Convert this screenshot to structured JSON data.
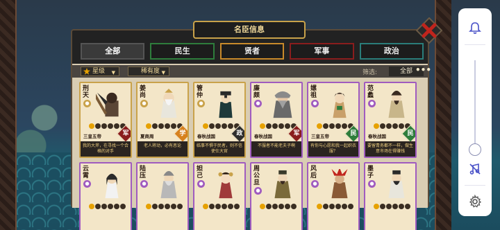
{
  "panel_title": "名臣信息",
  "tabs": [
    {
      "label": "全部",
      "active": true,
      "border": "#555555"
    },
    {
      "label": "民生",
      "active": false,
      "border": "#2e7d3c"
    },
    {
      "label": "贤者",
      "active": false,
      "border": "#c98a2a"
    },
    {
      "label": "军事",
      "active": false,
      "border": "#8a1d1d"
    },
    {
      "label": "政治",
      "active": false,
      "border": "#2a7d7a"
    }
  ],
  "filter": {
    "sort_star": "星级",
    "sort_rarity": "稀有度",
    "filter_label": "筛选:",
    "filter_value": "全部",
    "more": "•••"
  },
  "cards": [
    {
      "name": "刑天",
      "rarity": "gold",
      "era": "三皇五帝",
      "type": "军",
      "type_class": "type-mil",
      "stars": 1,
      "quote": "我的大斧，在寻找一个合格的对手",
      "portrait": "axe-warrior"
    },
    {
      "name": "姜尚",
      "rarity": "gold",
      "era": "夏商周",
      "type": "学",
      "type_class": "type-edu",
      "stars": 1,
      "quote": "老人将动，必有恶论",
      "portrait": "old-sage"
    },
    {
      "name": "管仲",
      "rarity": "gold",
      "era": "春秋战国",
      "type": "政",
      "type_class": "type-gov",
      "stars": 1,
      "quote": "临事不惧于民者，则不信使仕大官",
      "portrait": "official"
    },
    {
      "name": "廉颇",
      "rarity": "purple",
      "era": "春秋战国",
      "type": "军",
      "type_class": "type-mil",
      "stars": 1,
      "quote": "不服者不能老夫子啊",
      "portrait": "general"
    },
    {
      "name": "嫘祖",
      "rarity": "purple",
      "era": "三皇五帝",
      "type": "民",
      "type_class": "type-civ",
      "stars": 1,
      "quote": "有你与心愿和我一起织衣服？",
      "portrait": "lady"
    },
    {
      "name": "范蠡",
      "rarity": "purple",
      "era": "春秋战国",
      "type": "民",
      "type_class": "type-civ",
      "stars": 1,
      "quote": "要留青务都不一样，做生意市场在得赚钱",
      "portrait": "merchant"
    },
    {
      "name": "云霄",
      "rarity": "purple",
      "era": "",
      "type": "",
      "type_class": "",
      "stars": 1,
      "quote": "",
      "portrait": "fairy"
    },
    {
      "name": "陆压",
      "rarity": "purple",
      "era": "",
      "type": "",
      "type_class": "",
      "stars": 1,
      "quote": "",
      "portrait": "taoist"
    },
    {
      "name": "妲己",
      "rarity": "purple",
      "era": "",
      "type": "",
      "type_class": "",
      "stars": 1,
      "quote": "",
      "portrait": "consort"
    },
    {
      "name": "周公旦",
      "rarity": "purple",
      "era": "",
      "type": "",
      "type_class": "",
      "stars": 1,
      "quote": "",
      "portrait": "duke"
    },
    {
      "name": "风后",
      "rarity": "purple",
      "era": "",
      "type": "",
      "type_class": "",
      "stars": 1,
      "quote": "",
      "portrait": "tribal"
    },
    {
      "name": "墨子",
      "rarity": "purple",
      "era": "",
      "type": "",
      "type_class": "",
      "stars": 1,
      "quote": "",
      "portrait": "scholar"
    }
  ],
  "colors": {
    "gold_frame": "#c9a24a",
    "purple_frame": "#a05bbf",
    "card_bg": "#f3e6c8"
  },
  "icons": {
    "close": "close-x-icon",
    "bell": "bell-icon",
    "mute": "no-music-icon",
    "settings": "gear-icon",
    "star": "star-icon"
  }
}
